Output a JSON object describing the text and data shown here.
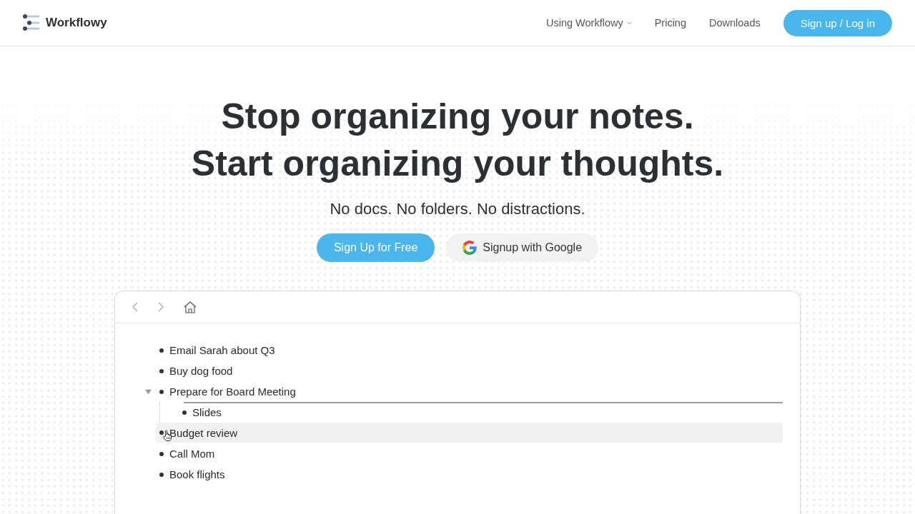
{
  "nav": {
    "brand": "Workflowy",
    "links": [
      {
        "label": "Using Workflowy",
        "dropdown": true
      },
      {
        "label": "Pricing",
        "dropdown": false
      },
      {
        "label": "Downloads",
        "dropdown": false
      }
    ],
    "cta": "Sign up / Log in"
  },
  "hero": {
    "headline": [
      "Stop organizing your notes.",
      "Start organizing your thoughts."
    ],
    "subtitle": "No docs. No folders. No distractions.",
    "buttons": [
      {
        "label": "Sign Up for Free",
        "kind": "primary"
      },
      {
        "label": "Signup with Google",
        "kind": "google"
      }
    ]
  },
  "app_preview": {
    "items": [
      {
        "text": "Email Sarah about Q3",
        "highlighted": false
      },
      {
        "text": "Buy dog food",
        "highlighted": false
      },
      {
        "text": "Prepare for Board Meeting",
        "highlighted": false,
        "expanded": true,
        "children": [
          {
            "text": "Slides",
            "highlighted": false
          }
        ]
      },
      {
        "text": "Budget review",
        "highlighted": true
      },
      {
        "text": "Call Mom",
        "highlighted": false
      },
      {
        "text": "Book flights",
        "highlighted": false
      }
    ]
  }
}
